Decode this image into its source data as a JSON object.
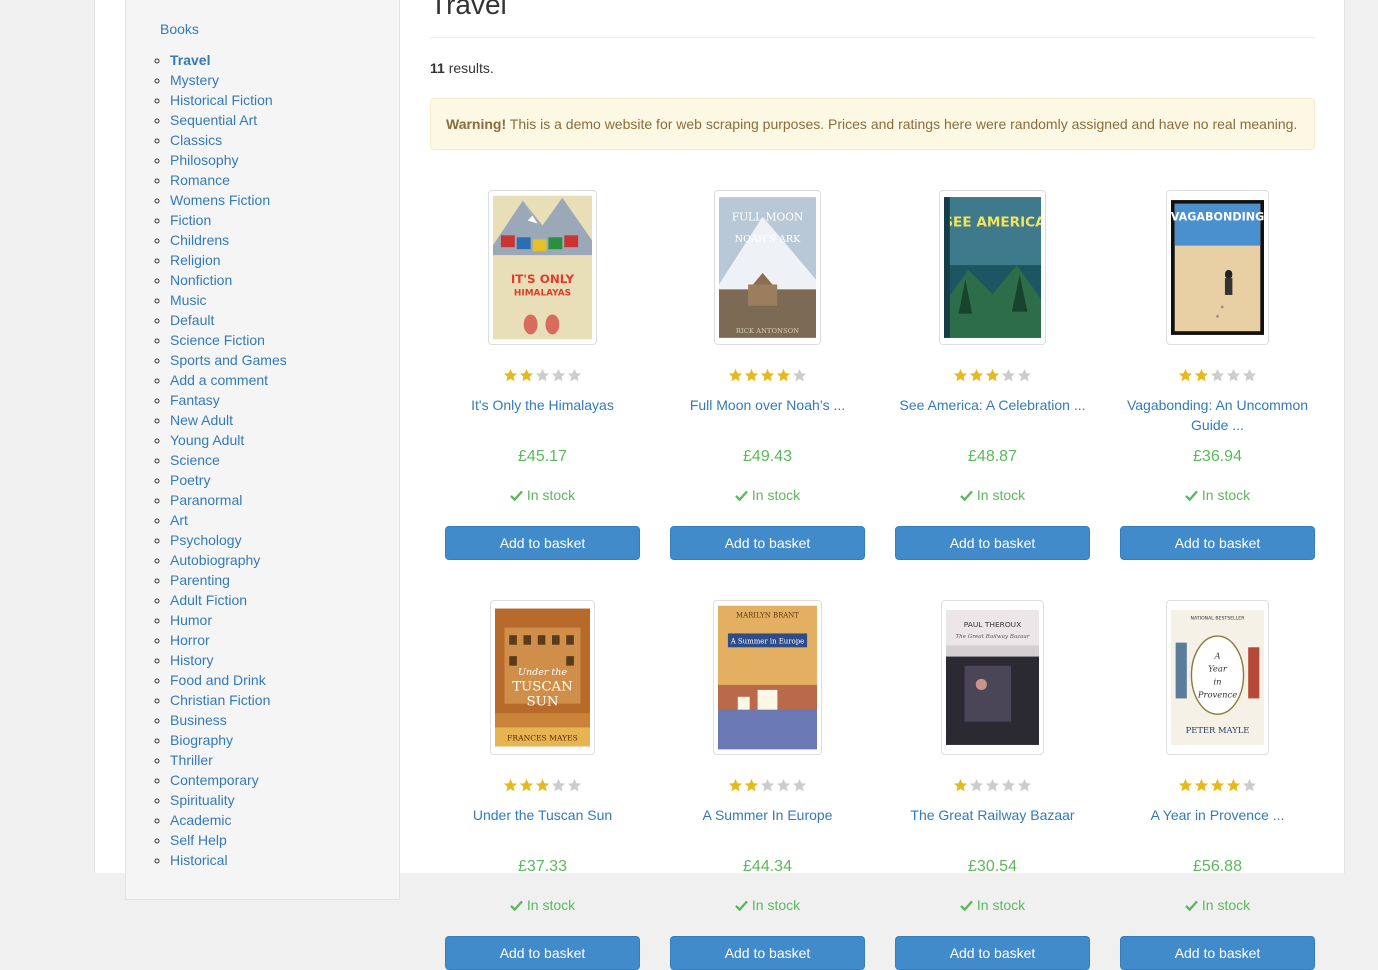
{
  "sidebar": {
    "root_label": "Books",
    "categories": [
      "Travel",
      "Mystery",
      "Historical Fiction",
      "Sequential Art",
      "Classics",
      "Philosophy",
      "Romance",
      "Womens Fiction",
      "Fiction",
      "Childrens",
      "Religion",
      "Nonfiction",
      "Music",
      "Default",
      "Science Fiction",
      "Sports and Games",
      "Add a comment",
      "Fantasy",
      "New Adult",
      "Young Adult",
      "Science",
      "Poetry",
      "Paranormal",
      "Art",
      "Psychology",
      "Autobiography",
      "Parenting",
      "Adult Fiction",
      "Humor",
      "Horror",
      "History",
      "Food and Drink",
      "Christian Fiction",
      "Business",
      "Biography",
      "Thriller",
      "Contemporary",
      "Spirituality",
      "Academic",
      "Self Help",
      "Historical"
    ],
    "active": "Travel"
  },
  "main": {
    "title": "Travel",
    "results_count": "11",
    "results_suffix": " results.",
    "warning_label": "Warning!",
    "warning_text": " This is a demo website for web scraping purposes. Prices and ratings here were randomly assigned and have no real meaning."
  },
  "colors": {
    "link": "#337ab7",
    "price": "#5cb85c",
    "button": "#428bca",
    "star_on": "#e6b91e",
    "star_off": "#cccccc",
    "warning_bg": "#fcf8e3"
  },
  "products": [
    {
      "title": "It's Only the Himalayas",
      "rating": 2,
      "price": "£45.17",
      "availability": "In stock",
      "button": "Add to basket",
      "cover_text": "IT'S ONLY THE HIMALAYAS"
    },
    {
      "title": "Full Moon over Noah’s ...",
      "rating": 4,
      "price": "£49.43",
      "availability": "In stock",
      "button": "Add to basket",
      "cover_text": "FULL MOON OVER NOAH'S ARK"
    },
    {
      "title": "See America: A Celebration ...",
      "rating": 3,
      "price": "£48.87",
      "availability": "In stock",
      "button": "Add to basket",
      "cover_text": "SEE AMERICA"
    },
    {
      "title": "Vagabonding: An Uncommon Guide ...",
      "rating": 2,
      "price": "£36.94",
      "availability": "In stock",
      "button": "Add to basket",
      "cover_text": "VAGABONDING"
    },
    {
      "title": "Under the Tuscan Sun",
      "rating": 3,
      "price": "£37.33",
      "availability": "In stock",
      "button": "Add to basket",
      "cover_text": "UNDER THE TUSCAN SUN"
    },
    {
      "title": "A Summer In Europe",
      "rating": 2,
      "price": "£44.34",
      "availability": "In stock",
      "button": "Add to basket",
      "cover_text": "MARILYN BRANT"
    },
    {
      "title": "The Great Railway Bazaar",
      "rating": 1,
      "price": "£30.54",
      "availability": "In stock",
      "button": "Add to basket",
      "cover_text": "PAUL THEROUX"
    },
    {
      "title": "A Year in Provence ...",
      "rating": 4,
      "price": "£56.88",
      "availability": "In stock",
      "button": "Add to basket",
      "cover_text": "PETER MAYLE"
    }
  ]
}
